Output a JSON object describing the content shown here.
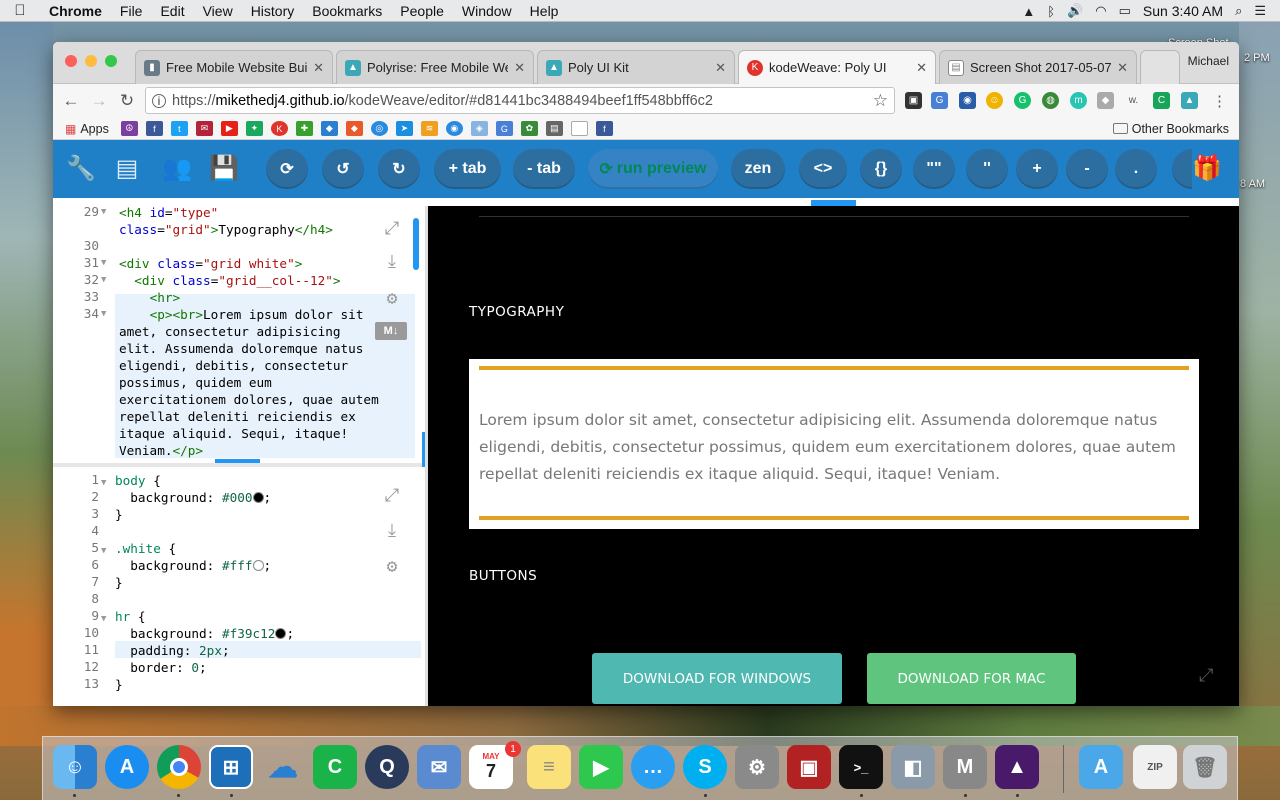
{
  "menubar": {
    "app_name": "Chrome",
    "items": [
      "File",
      "Edit",
      "View",
      "History",
      "Bookmarks",
      "People",
      "Window",
      "Help"
    ],
    "clock": "Sun 3:40 AM"
  },
  "desktop": {
    "file_label": "Screen Shot",
    "time_label_1": "2 PM",
    "time_label_2": "8 AM"
  },
  "browser": {
    "profile": "Michael",
    "tabs": [
      {
        "title": "Free Mobile Website Build",
        "icon": "mobirise-icon",
        "color": "#6a7b88"
      },
      {
        "title": "Polyrise: Free Mobile Web",
        "icon": "polyrise-icon",
        "color": "#3aa8b6"
      },
      {
        "title": "Poly UI Kit",
        "icon": "polyui-icon",
        "color": "#3aa8b6"
      },
      {
        "title": "kodeWeave: Poly UI",
        "icon": "kodeweave-icon",
        "color": "#e0332b"
      },
      {
        "title": "Screen Shot 2017-05-07 a",
        "icon": "document-icon",
        "color": "#888888"
      }
    ],
    "url_host": "mikethedj4.github.io",
    "url_path": "/kodeWeave/editor/#d81441bc3488494beef1ff548bbff6c2",
    "url_scheme": "https://",
    "bookmarks_apps": "Apps",
    "other_bookmarks": "Other Bookmarks"
  },
  "app_toolbar": {
    "buttons": [
      "+ tab",
      "- tab",
      "run preview",
      "zen",
      "<>",
      "{}",
      "\"\"",
      "''",
      "+",
      "-",
      "."
    ]
  },
  "html_editor": {
    "lines": [
      {
        "n": "29",
        "fold": true
      },
      {
        "n": "",
        "fold": false
      },
      {
        "n": "30",
        "fold": false
      },
      {
        "n": "31",
        "fold": true
      },
      {
        "n": "32",
        "fold": true
      },
      {
        "n": "33",
        "fold": false
      },
      {
        "n": "34",
        "fold": true
      }
    ],
    "badge": "M↓"
  },
  "css_editor": {
    "lines": [
      "1",
      "2",
      "3",
      "4",
      "5",
      "6",
      "7",
      "8",
      "9",
      "10",
      "11",
      "12",
      "13"
    ],
    "colors": {
      "black": "#000",
      "white": "#fff",
      "accent": "#f39c12"
    }
  },
  "preview": {
    "typography_title": "TYPOGRAPHY",
    "paragraph": "Lorem ipsum dolor sit amet, consectetur adipisicing elit. Assumenda doloremque natus eligendi, debitis, consectetur possimus, quidem eum exercitationem dolores, quae autem repellat deleniti reiciendis ex itaque aliquid. Sequi, itaque! Veniam.",
    "buttons_title": "BUTTONS",
    "download_windows": "DOWNLOAD FOR WINDOWS",
    "download_mac": "DOWNLOAD FOR MAC",
    "accent_color": "#e3a124",
    "windows_btn_color": "#4fb8b0",
    "mac_btn_color": "#5fc47e"
  },
  "dock": {
    "calendar_month": "MAY",
    "calendar_day": "7",
    "calendar_badge": "1",
    "apps": [
      "finder-icon",
      "app-store-icon",
      "chrome-icon",
      "code-editor-icon",
      "cloud-icon",
      "camtasia-icon",
      "quicktime-icon",
      "mail-icon",
      "calendar-icon",
      "notes-icon",
      "facetime-icon",
      "messages-icon",
      "skype-icon",
      "system-preferences-icon",
      "photo-booth-icon",
      "terminal-icon",
      "preview-icon",
      "mobirise-icon",
      "affinity-photo-icon",
      "applications-folder-icon",
      "archive-icon",
      "trash-icon"
    ]
  }
}
